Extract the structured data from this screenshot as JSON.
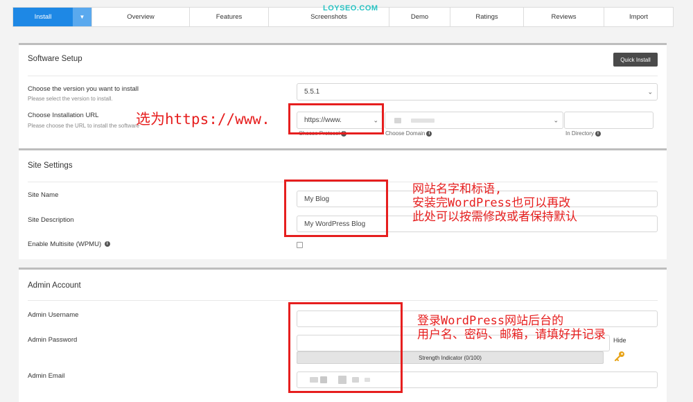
{
  "watermark": "LOYSEO.COM",
  "tabs": [
    {
      "label": "Install",
      "active": true
    },
    {
      "label": "Overview"
    },
    {
      "label": "Features"
    },
    {
      "label": "Screenshots"
    },
    {
      "label": "Demo"
    },
    {
      "label": "Ratings"
    },
    {
      "label": "Reviews"
    },
    {
      "label": "Import"
    }
  ],
  "software_setup": {
    "title": "Software Setup",
    "quick_install": "Quick Install",
    "version_label": "Choose the version you want to install",
    "version_help": "Please select the version to install.",
    "version_value": "5.5.1",
    "url_label": "Choose Installation URL",
    "url_help": "Please choose the URL to install the software",
    "protocol_value": "https://www.",
    "protocol_caption": "Choose Protocol",
    "domain_caption": "Choose Domain",
    "directory_caption": "In Directory"
  },
  "site_settings": {
    "title": "Site Settings",
    "site_name_label": "Site Name",
    "site_name_value": "My Blog",
    "site_desc_label": "Site Description",
    "site_desc_value": "My WordPress Blog",
    "multisite_label": "Enable Multisite (WPMU)"
  },
  "admin_account": {
    "title": "Admin Account",
    "username_label": "Admin Username",
    "password_label": "Admin Password",
    "hide_label": "Hide",
    "strength_label": "Strength Indicator (0/100)",
    "email_label": "Admin Email"
  },
  "annotations": {
    "protocol_note": "选为https://www.",
    "site_note_1": "网站名字和标语,",
    "site_note_2": "安装完WordPress也可以再改",
    "site_note_3": "此处可以按需修改或者保持默认",
    "admin_note_1": "登录WordPress网站后台的",
    "admin_note_2": "用户名、密码、邮箱，请填好并记录"
  },
  "colors": {
    "accent": "#1e88e5",
    "annotation_red": "#e61e1e",
    "watermark": "#27c2c2"
  }
}
